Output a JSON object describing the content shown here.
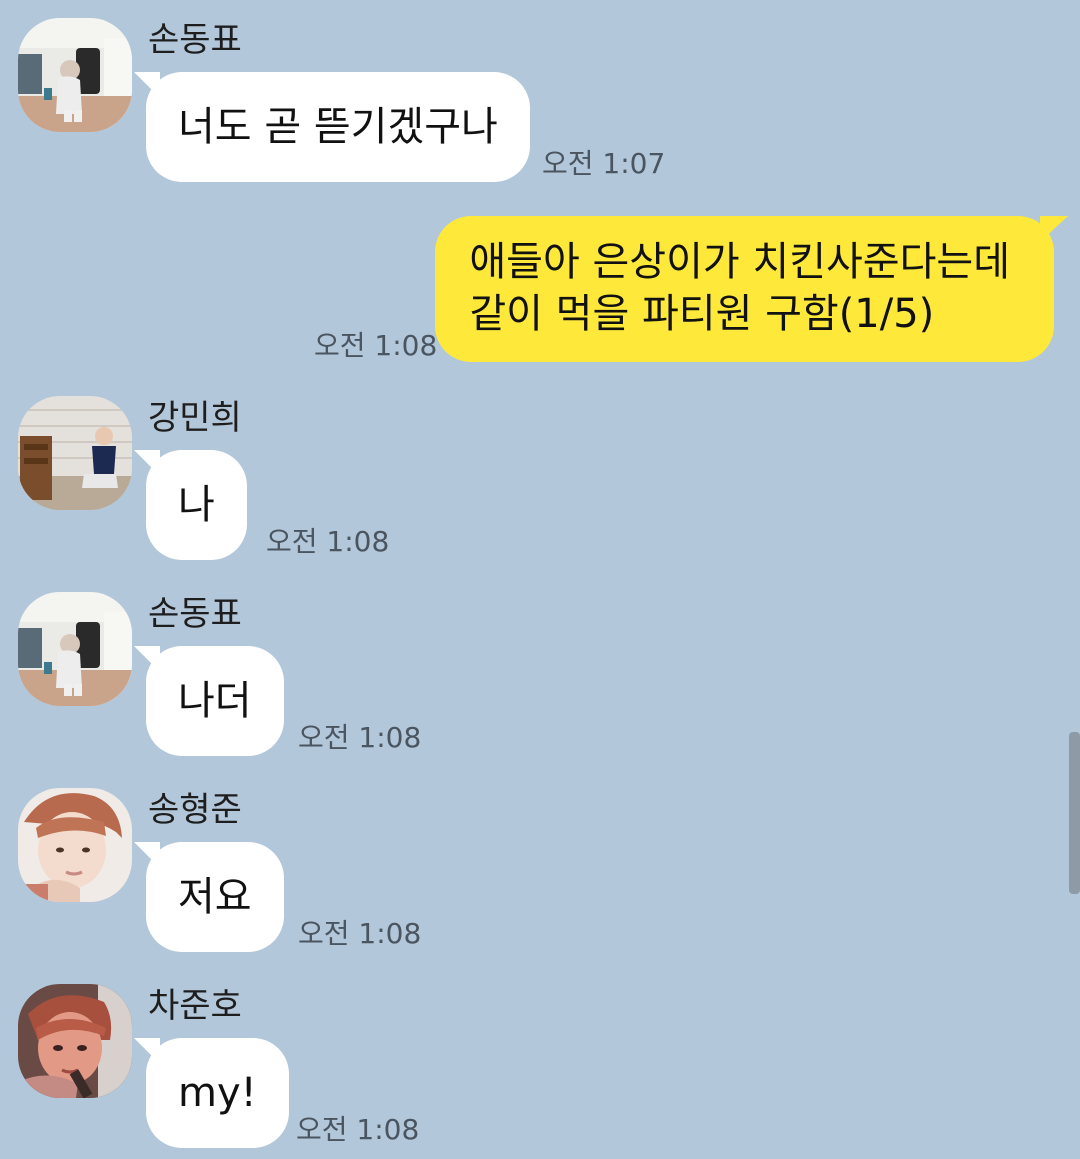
{
  "messages": [
    {
      "sender": "손동표",
      "text": "너도 곧 뜯기겠구나",
      "time": "오전 1:07",
      "avatar": "photo-room-suitcase"
    },
    {
      "sender": "",
      "lines": [
        "애들아 은상이가 치킨사준다는데",
        "같이 먹을 파티원 구함(1/5)"
      ],
      "time": "오전 1:08",
      "mine": true
    },
    {
      "sender": "강민희",
      "text": "나",
      "time": "오전 1:08",
      "avatar": "photo-room-sitting"
    },
    {
      "sender": "손동표",
      "text": "나더",
      "time": "오전 1:08",
      "avatar": "photo-room-suitcase"
    },
    {
      "sender": "송형준",
      "text": "저요",
      "time": "오전 1:08",
      "avatar": "photo-face-pink"
    },
    {
      "sender": "차준호",
      "text": "my!",
      "time": "오전 1:08",
      "avatar": "photo-face-red"
    }
  ],
  "colors": {
    "background": "#b2c7da",
    "my_bubble": "#fee93b",
    "other_bubble": "#ffffff"
  }
}
